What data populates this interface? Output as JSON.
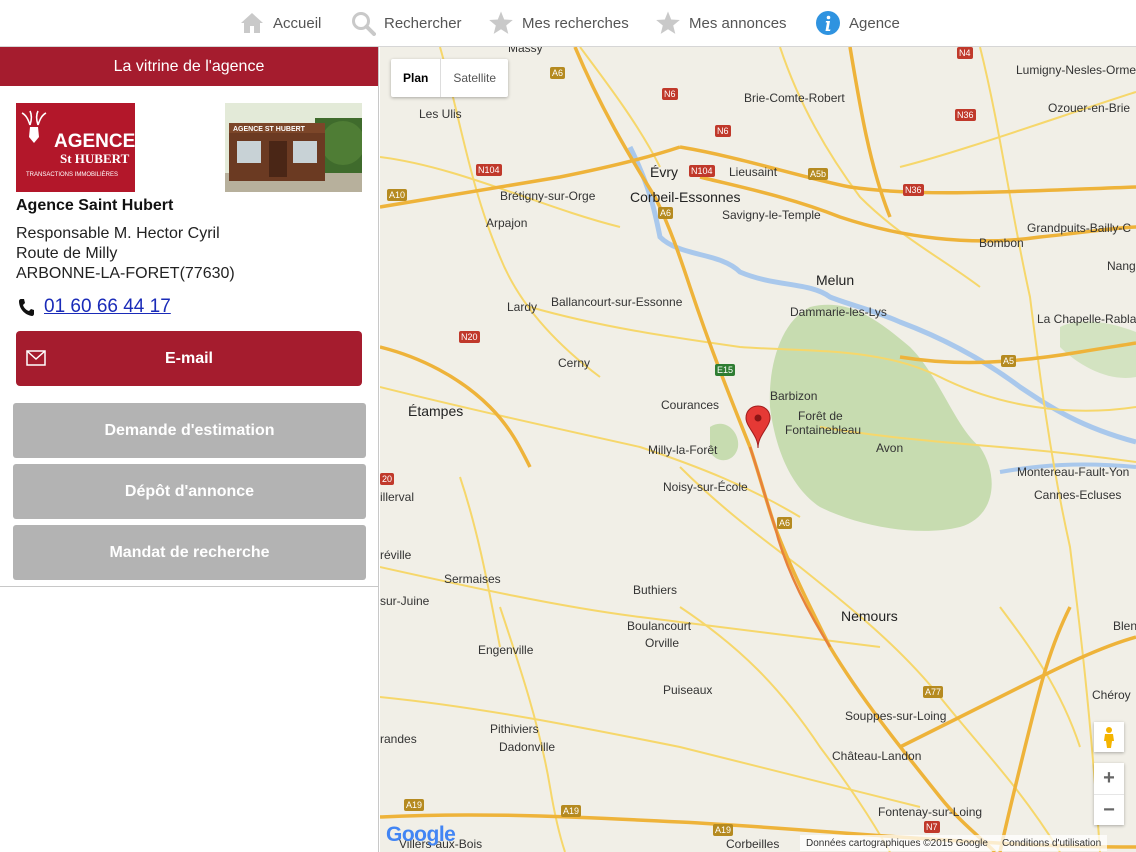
{
  "nav": {
    "items": [
      {
        "label": "Accueil",
        "icon": "home-icon"
      },
      {
        "label": "Rechercher",
        "icon": "search-icon"
      },
      {
        "label": "Mes recherches",
        "icon": "star-icon"
      },
      {
        "label": "Mes annonces",
        "icon": "star-icon"
      },
      {
        "label": "Agence",
        "icon": "info-icon"
      }
    ]
  },
  "agency": {
    "header": "La vitrine de l'agence",
    "logo_text_1": "AGENCE",
    "logo_text_2": "St HUBERT",
    "logo_text_3": "TRANSACTIONS IMMOBILIÈRES",
    "storefront_sign": "AGENCE ST HUBERT",
    "name": "Agence Saint Hubert",
    "manager": "Responsable M. Hector Cyril",
    "street": "Route de Milly",
    "city": "ARBONNE-LA-FORET(77630)",
    "phone": "01 60 66 44 17",
    "email_label": "E-mail",
    "buttons": [
      "Demande d'estimation",
      "Dépôt d'annonce",
      "Mandat de recherche"
    ]
  },
  "map": {
    "type_plan": "Plan",
    "type_satellite": "Satellite",
    "zoom_in": "+",
    "zoom_out": "−",
    "logo": "Google",
    "attribution": "Données cartographiques ©2015 Google",
    "terms": "Conditions d'utilisation",
    "places": {
      "massy": "Massy",
      "brie": "Brie-Comte-Robert",
      "lumigny": "Lumigny-Nesles-Ormeaux",
      "ozoir": "Ozouer-en-Brie",
      "ulis": "Les Ulis",
      "evry": "Évry",
      "lieusaint": "Lieusaint",
      "bretigny": "Brétigny-sur-Orge",
      "corbeil": "Corbeil-Essonnes",
      "savigny": "Savigny-le-Temple",
      "arpajon": "Arpajon",
      "grandpuits": "Grandpuits-Bailly-C",
      "bombon": "Bombon",
      "melun": "Melun",
      "nang": "Nang",
      "ballancourt": "Ballancourt-sur-Essonne",
      "dammarie": "Dammarie-les-Lys",
      "lardy": "Lardy",
      "chapelle": "La Chapelle-Rablais",
      "cerny": "Cerny",
      "barbizon": "Barbizon",
      "etampes": "Étampes",
      "courances": "Courances",
      "foret1": "Forêt de",
      "foret2": "Fontainebleau",
      "milly": "Milly-la-Forêt",
      "avon": "Avon",
      "montereau": "Montereau-Fault-Yon",
      "noisy": "Noisy-sur-École",
      "cannes": "Cannes-Ecluses",
      "millerval": "illerval",
      "reville": "réville",
      "sermaises": "Sermaises",
      "buthiers": "Buthiers",
      "juine": "sur-Juine",
      "nemours": "Nemours",
      "blen": "Blen",
      "boulancourt": "Boulancourt",
      "orville": "Orville",
      "engenville": "Engenville",
      "cherov": "Chéroy",
      "puiseaux": "Puiseaux",
      "souppes": "Souppes-sur-Loing",
      "pithiviers": "Pithiviers",
      "grandes": "randes",
      "dadonville": "Dadonville",
      "chateau": "Château-Landon",
      "fontenay": "Fontenay-sur-Loing",
      "bois": "Villers-aux-Bois",
      "corbeilles": "Corbeilles"
    },
    "roads": {
      "a6a": "A6",
      "n6a": "N6",
      "n6b": "N6",
      "n104a": "N104",
      "n104b": "N104",
      "a5b": "A5b",
      "n36a": "N36",
      "n36b": "N36",
      "n4": "N4",
      "a10": "A10",
      "a6b": "A6",
      "n20a": "N20",
      "e15": "E15",
      "a5": "A5",
      "n20b": "20",
      "a6c": "A6",
      "a77": "A77",
      "a19a": "A19",
      "a19b": "A19",
      "a19c": "A19",
      "n7": "N7"
    }
  }
}
